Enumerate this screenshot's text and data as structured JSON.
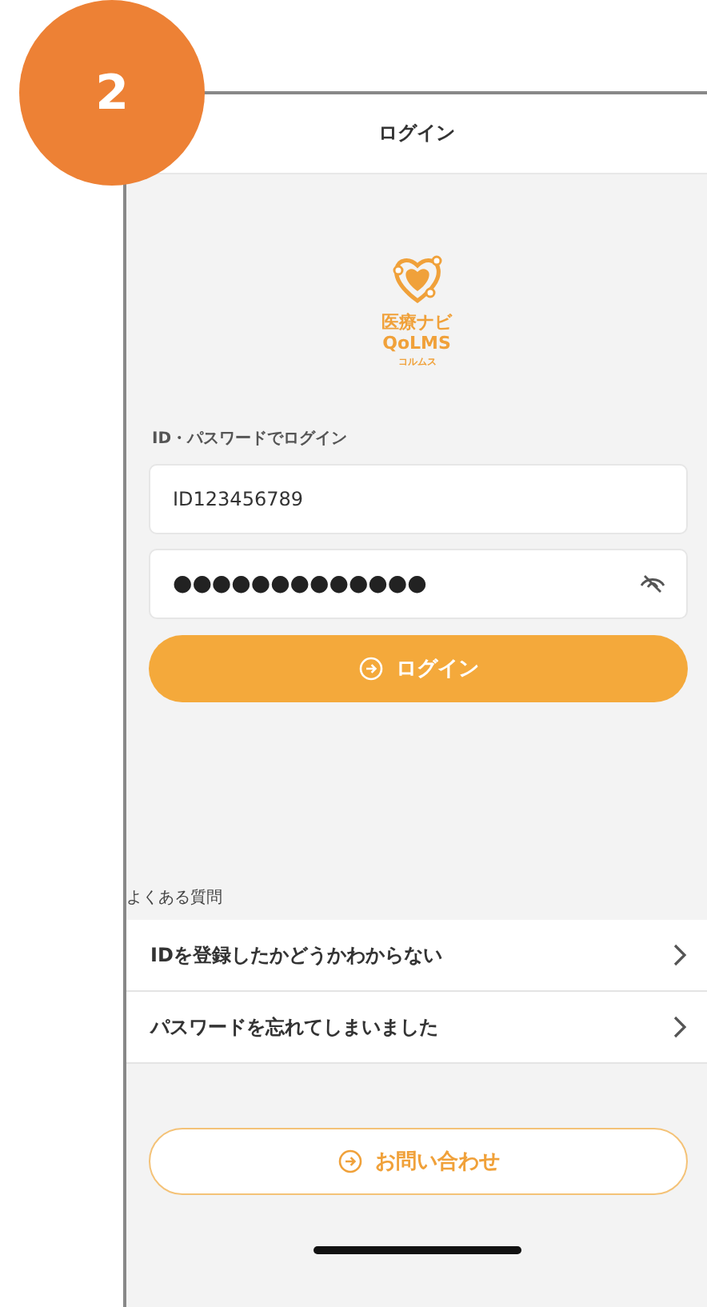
{
  "badge": {
    "number": "2"
  },
  "header": {
    "title": "ログイン"
  },
  "logo": {
    "line_1": "医療ナビ",
    "line_2": "QoLMS",
    "line_3": "コルムス"
  },
  "login_form": {
    "section_label": "ID・パスワードでログイン",
    "id_field": {
      "value": "ID123456789"
    },
    "password_field": {
      "value": "●●●●●●●●●●●●●"
    },
    "login_button": {
      "label": "ログイン"
    }
  },
  "faq": {
    "title": "よくある質問",
    "items": [
      {
        "label": "IDを登録したかどうかわからない"
      },
      {
        "label": "パスワードを忘れてしまいました"
      }
    ]
  },
  "contact_button": {
    "label": "お問い合わせ"
  }
}
